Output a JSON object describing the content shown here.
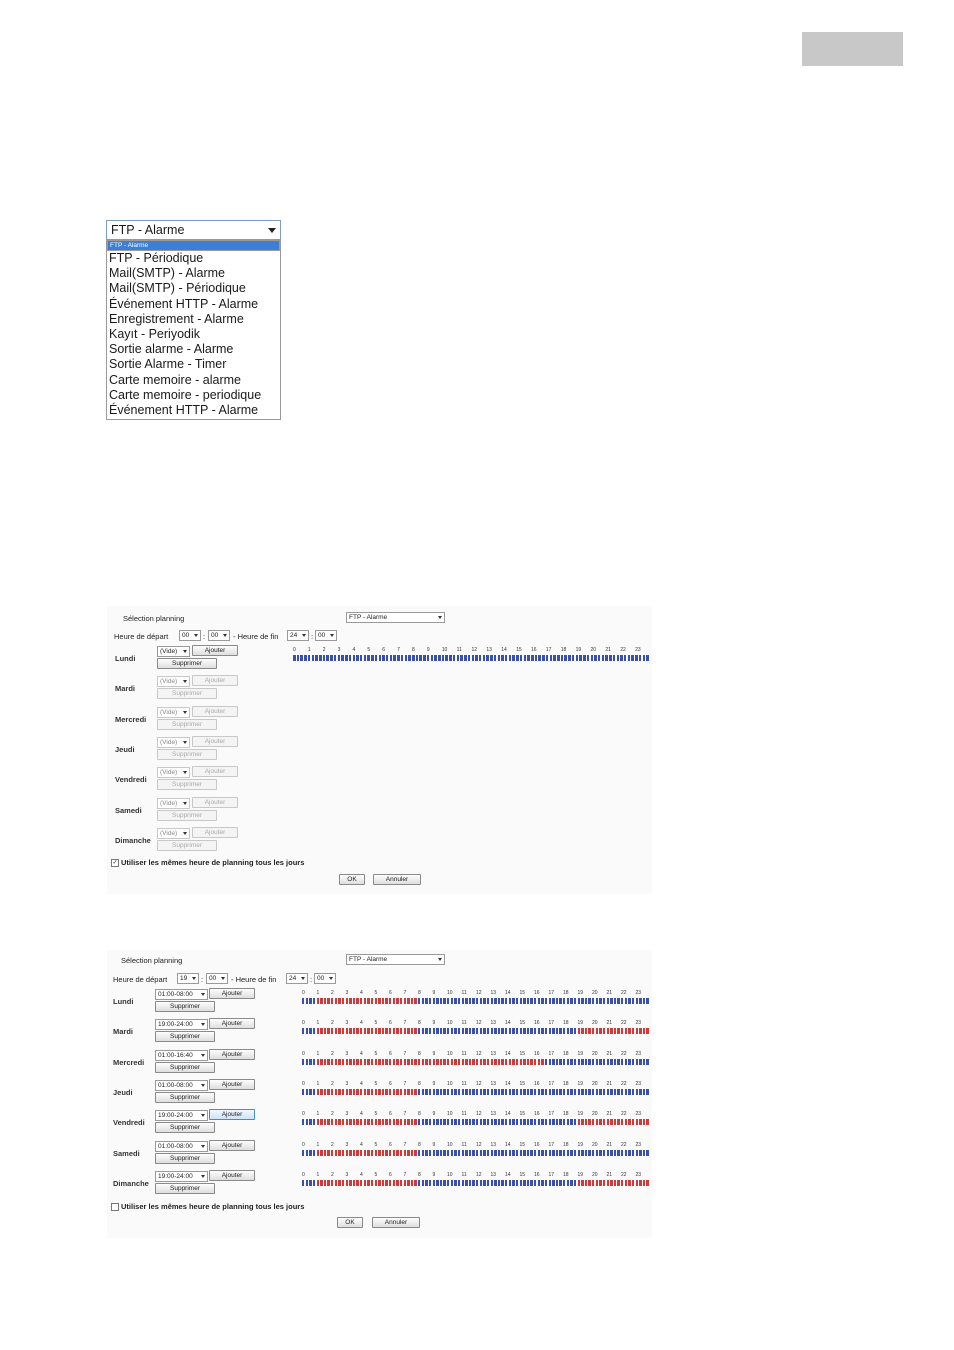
{
  "dropdown": {
    "selected": "FTP - Alarme",
    "options": [
      "FTP - Alarme",
      "FTP - Périodique",
      "Mail(SMTP) - Alarme",
      "Mail(SMTP) - Périodique",
      "Événement HTTP - Alarme",
      "Enregistrement - Alarme",
      "Kayıt - Periyodik",
      "Sortie alarme - Alarme",
      "Sortie Alarme - Timer",
      "Carte memoire - alarme",
      "Carte memoire - periodique",
      "Événement HTTP - Alarme"
    ]
  },
  "colors": {
    "bar_inactive": "#3b4fb0",
    "bar_active": "#d23a3a",
    "highlight": "#3d7fd4"
  },
  "hours": [
    "0",
    "1",
    "2",
    "3",
    "4",
    "5",
    "6",
    "7",
    "8",
    "9",
    "10",
    "11",
    "12",
    "13",
    "14",
    "15",
    "16",
    "17",
    "18",
    "19",
    "20",
    "21",
    "22",
    "23"
  ],
  "panels": [
    {
      "selection_label": "Sélection planning",
      "selection_value": "FTP - Alarme",
      "start_label": "Heure de départ",
      "start_h": "00",
      "start_m": "00",
      "end_label": "- Heure de fin",
      "end_h": "24",
      "end_m": "00",
      "same_hours_label": "Utiliser les mêmes heure de planning tous les jours",
      "same_hours_checked": true,
      "ok_label": "OK",
      "cancel_label": "Annuler",
      "add_label": "Ajouter",
      "delete_label": "Supprimer",
      "days": [
        {
          "name": "Lundi",
          "value": "(Vide)",
          "enabled": true,
          "show_bar": true,
          "active": []
        },
        {
          "name": "Mardi",
          "value": "(Vide)",
          "enabled": false,
          "show_bar": false,
          "active": []
        },
        {
          "name": "Mercredi",
          "value": "(Vide)",
          "enabled": false,
          "show_bar": false,
          "active": []
        },
        {
          "name": "Jeudi",
          "value": "(Vide)",
          "enabled": false,
          "show_bar": false,
          "active": []
        },
        {
          "name": "Vendredi",
          "value": "(Vide)",
          "enabled": false,
          "show_bar": false,
          "active": []
        },
        {
          "name": "Samedi",
          "value": "(Vide)",
          "enabled": false,
          "show_bar": false,
          "active": []
        },
        {
          "name": "Dimanche",
          "value": "(Vide)",
          "enabled": false,
          "show_bar": false,
          "active": []
        }
      ]
    },
    {
      "selection_label": "Sélection planning",
      "selection_value": "FTP - Alarme",
      "start_label": "Heure de départ",
      "start_h": "19",
      "start_m": "00",
      "end_label": "- Heure de fin",
      "end_h": "24",
      "end_m": "00",
      "same_hours_label": "Utiliser les mêmes heure de planning tous les jours",
      "same_hours_checked": false,
      "ok_label": "OK",
      "cancel_label": "Annuler",
      "add_label": "Ajouter",
      "delete_label": "Supprimer",
      "days": [
        {
          "name": "Lundi",
          "value": "01:00-08:00",
          "enabled": true,
          "show_bar": true,
          "focus": false,
          "active": [
            [
              1,
              8
            ]
          ]
        },
        {
          "name": "Mardi",
          "value": "19:00-24:00",
          "enabled": true,
          "show_bar": true,
          "focus": false,
          "active": [
            [
              1,
              8
            ],
            [
              19,
              24
            ]
          ]
        },
        {
          "name": "Mercredi",
          "value": "01:00-16:40",
          "enabled": true,
          "show_bar": true,
          "focus": false,
          "active": [
            [
              1,
              16.67
            ]
          ]
        },
        {
          "name": "Jeudi",
          "value": "01:00-08:00",
          "enabled": true,
          "show_bar": true,
          "focus": false,
          "active": [
            [
              1,
              8
            ]
          ]
        },
        {
          "name": "Vendredi",
          "value": "19:00-24:00",
          "enabled": true,
          "show_bar": true,
          "focus": true,
          "active": [
            [
              1,
              8
            ],
            [
              19,
              24
            ]
          ]
        },
        {
          "name": "Samedi",
          "value": "01:00-08:00",
          "enabled": true,
          "show_bar": true,
          "focus": false,
          "active": [
            [
              1,
              8
            ]
          ]
        },
        {
          "name": "Dimanche",
          "value": "19:00-24:00",
          "enabled": true,
          "show_bar": true,
          "focus": false,
          "active": [
            [
              1,
              8
            ],
            [
              19,
              24
            ]
          ]
        }
      ]
    }
  ]
}
